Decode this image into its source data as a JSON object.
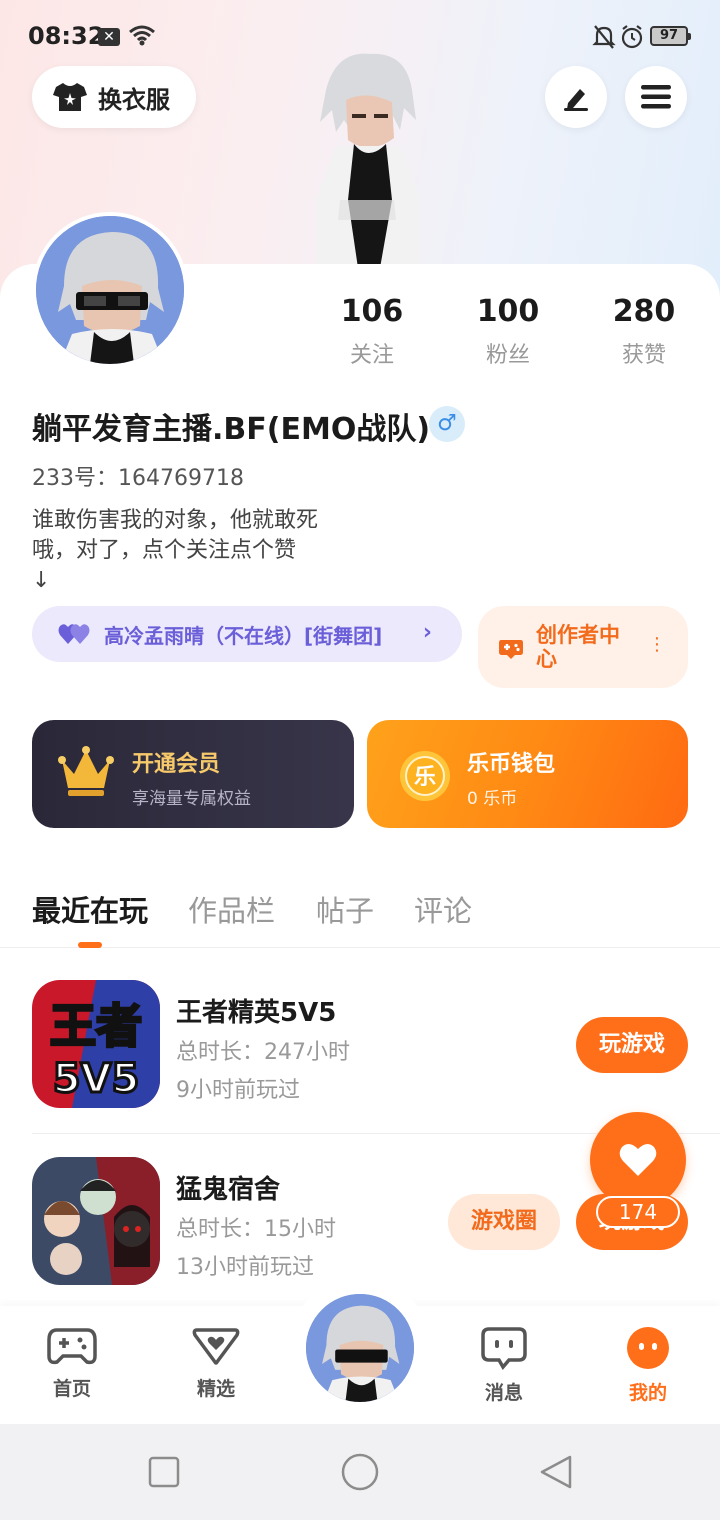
{
  "status_bar": {
    "time": "08:32",
    "battery": "97"
  },
  "top": {
    "outfit_label": "换衣服"
  },
  "stats": [
    {
      "value": "106",
      "label": "关注"
    },
    {
      "value": "100",
      "label": "粉丝"
    },
    {
      "value": "280",
      "label": "获赞"
    }
  ],
  "profile": {
    "name": "躺平发育主播.BF(EMO战队)",
    "gender": "♂",
    "uid": "233号：164769718",
    "bio": "谁敢伤害我的对象，他就敢死\n哦，对了，点个关注点个赞\n↓"
  },
  "team": {
    "label": "高冷孟雨晴（不在线）[街舞团]",
    "arrow": "›"
  },
  "creator": {
    "label": "创作者中心",
    "dots": "⋮"
  },
  "vip": {
    "title": "开通会员",
    "subtitle": "享海量专属权益"
  },
  "wallet": {
    "title": "乐币钱包",
    "subtitle": "0 乐币",
    "coin_glyph": "乐"
  },
  "tabs": [
    "最近在玩",
    "作品栏",
    "帖子",
    "评论"
  ],
  "games": [
    {
      "title": "王者精英5V5",
      "duration": "总时长：247小时",
      "last_played": "9小时前玩过",
      "play_label": "玩游戏",
      "icon_text_1": "王者",
      "icon_text_2": "5V5"
    },
    {
      "title": "猛鬼宿舍",
      "duration": "总时长：15小时",
      "last_played": "13小时前玩过",
      "circle_label": "游戏圈",
      "play_label": "玩游戏"
    }
  ],
  "like": {
    "count": "174"
  },
  "nav": [
    {
      "label": "首页",
      "icon": "gamepad-icon"
    },
    {
      "label": "精选",
      "icon": "heart-box-icon"
    },
    {
      "label": "消息",
      "icon": "chat-icon"
    },
    {
      "label": "我的",
      "icon": "me-icon"
    }
  ],
  "colors": {
    "accent": "#ff6f1a",
    "team": "#6b5fd9",
    "vip_gold": "#f7c96a"
  }
}
